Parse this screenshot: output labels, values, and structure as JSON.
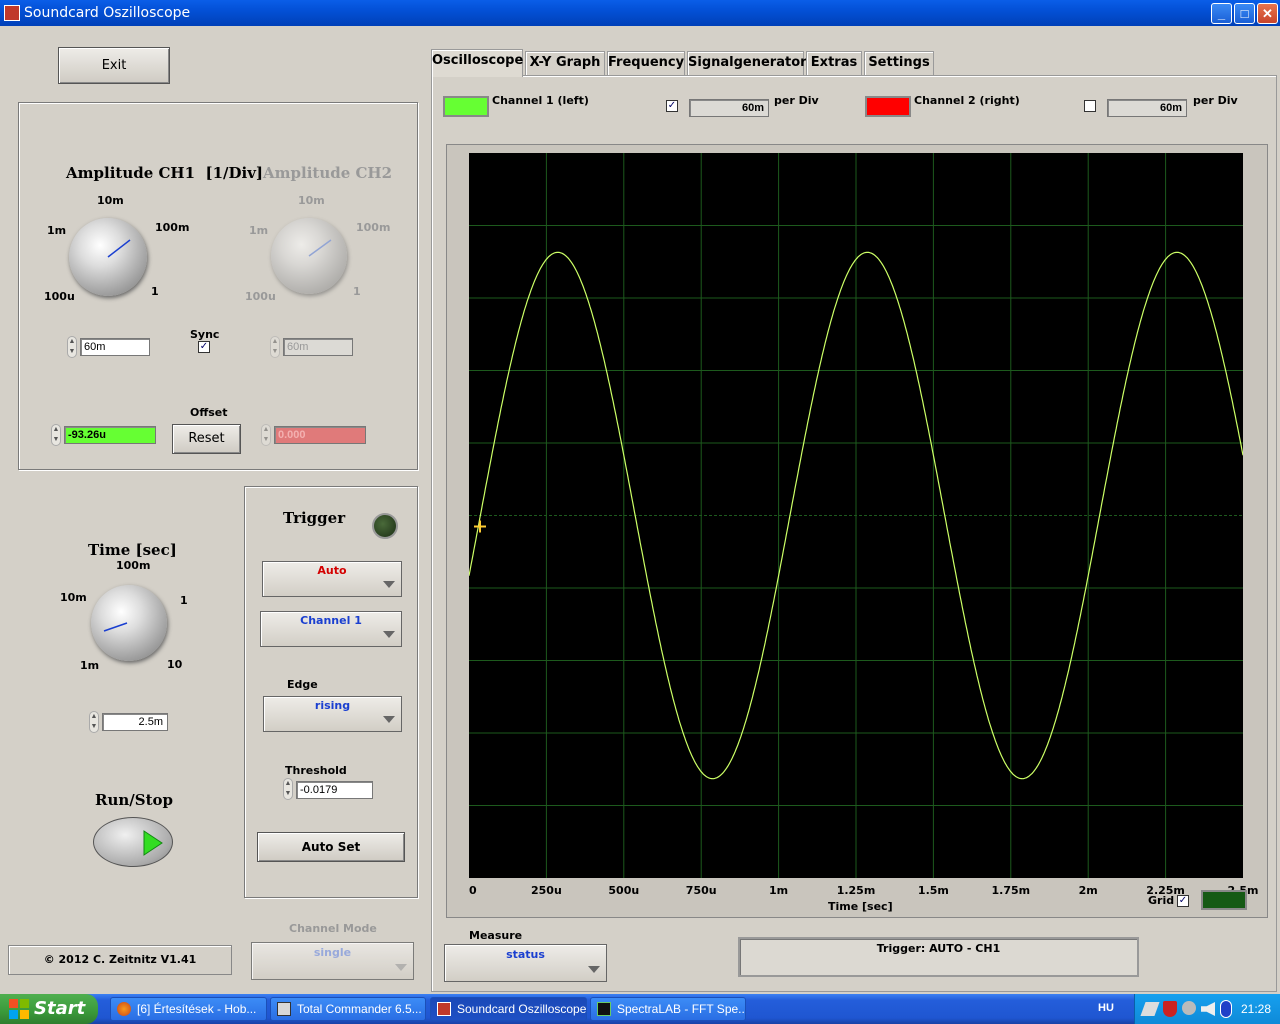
{
  "window": {
    "title": "Soundcard Oszilloscope"
  },
  "left": {
    "exit_label": "Exit",
    "amp_ch1_title": "Amplitude CH1",
    "amp_ch1_unit": "[1/Div]",
    "amp_ch2_title": "Amplitude CH2",
    "amp_knob_labels": {
      "a": "1m",
      "b": "10m",
      "c": "100m",
      "d": "1",
      "e": "100u"
    },
    "sync_label": "Sync",
    "ch1_amp_value": "60m",
    "ch2_amp_value": "60m",
    "offset_label": "Offset",
    "reset_label": "Reset",
    "ch1_offset_value": "-93.26u",
    "ch2_offset_value": "0.000",
    "time_title": "Time [sec]",
    "time_knob_labels": {
      "a": "10m",
      "b": "100m",
      "c": "1",
      "d": "1m",
      "e": "10"
    },
    "time_value": "2.5m",
    "run_stop_label": "Run/Stop",
    "copyright": "© 2012   C. Zeitnitz V1.41",
    "channel_mode_label": "Channel Mode",
    "channel_mode_value": "single"
  },
  "trigger": {
    "title": "Trigger",
    "mode": "Auto",
    "channel": "Channel 1",
    "edge_label": "Edge",
    "edge_value": "rising",
    "threshold_label": "Threshold",
    "threshold_value": "-0.0179",
    "auto_set_label": "Auto Set"
  },
  "tabs": [
    "Oscilloscope",
    "X-Y Graph",
    "Frequency",
    "Signalgenerator",
    "Extras",
    "Settings"
  ],
  "channels": {
    "ch1_label": "Channel 1 (left)",
    "ch1_per_div": "60m",
    "ch2_label": "Channel 2 (right)",
    "ch2_per_div": "60m",
    "per_div_label": "per Div",
    "ch1_color": "#66ff33",
    "ch2_color": "#ff0000"
  },
  "chart_data": {
    "type": "line",
    "xlabel": "Time [sec]",
    "x_tick_labels": [
      "0",
      "250u",
      "500u",
      "750u",
      "1m",
      "1.25m",
      "1.5m",
      "1.75m",
      "2m",
      "2.25m",
      "2.5m"
    ],
    "xlim": [
      0,
      0.0025
    ],
    "ylim": [
      -5,
      5
    ],
    "grid": true,
    "series": [
      {
        "color": "#ccff66",
        "waveform": "sine",
        "frequency_hz": 1000,
        "amplitude_div": 3.63,
        "phase_at_zero_div": -0.83
      }
    ]
  },
  "grid_label": "Grid",
  "measure": {
    "label": "Measure",
    "value": "status"
  },
  "status_text": "Trigger: AUTO - CH1",
  "taskbar": {
    "start": "Start",
    "items": [
      "[6] Értesítések - Hob...",
      "Total Commander 6.5...",
      "Soundcard Oszilloscope",
      "SpectraLAB - FFT Spe..."
    ],
    "lang": "HU",
    "clock": "21:28"
  }
}
